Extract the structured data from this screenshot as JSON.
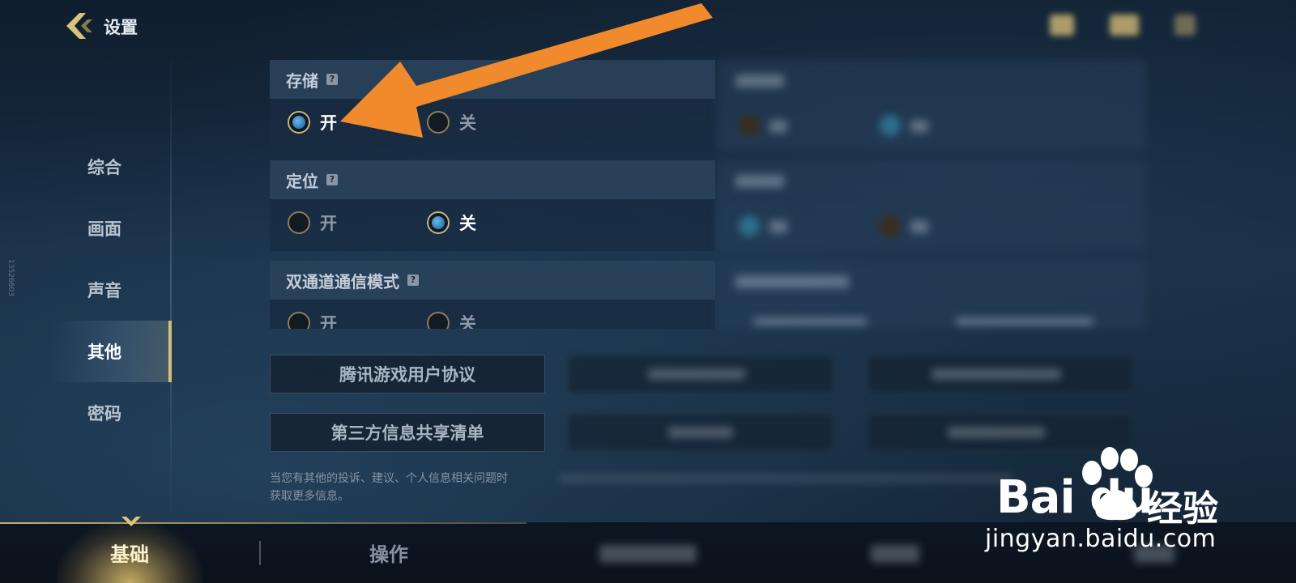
{
  "header": {
    "title": "设置"
  },
  "sidebar": {
    "vertical_code": "13526603",
    "items": [
      {
        "label": "综合"
      },
      {
        "label": "画面"
      },
      {
        "label": "声音"
      },
      {
        "label": "其他",
        "active": true
      },
      {
        "label": "密码"
      }
    ]
  },
  "settings": [
    {
      "title": "存储",
      "help": "?",
      "on_label": "开",
      "off_label": "关",
      "selected": "开"
    },
    {
      "title": "定位",
      "help": "?",
      "on_label": "开",
      "off_label": "关",
      "selected": "关"
    },
    {
      "title": "双通道通信模式",
      "help": "?",
      "on_label": "开",
      "off_label": "关"
    }
  ],
  "buttons": {
    "user_agreement": "腾讯游戏用户协议",
    "third_party_list": "第三方信息共享清单"
  },
  "note": {
    "line1": "当您有其他的投诉、建议、个人信息相关问题时",
    "line2": "获取更多信息。"
  },
  "bottom_tabs": [
    {
      "label": "基础",
      "active": true
    },
    {
      "label": "操作"
    }
  ],
  "watermark": {
    "brand_latin": "Bai du",
    "brand_cn": "经验",
    "url": "jingyan.baidu.com"
  },
  "colors": {
    "accent_gold": "#e3c474",
    "radio_selected_blue": "#2a78b3",
    "arrow_orange": "#f08a2c"
  }
}
